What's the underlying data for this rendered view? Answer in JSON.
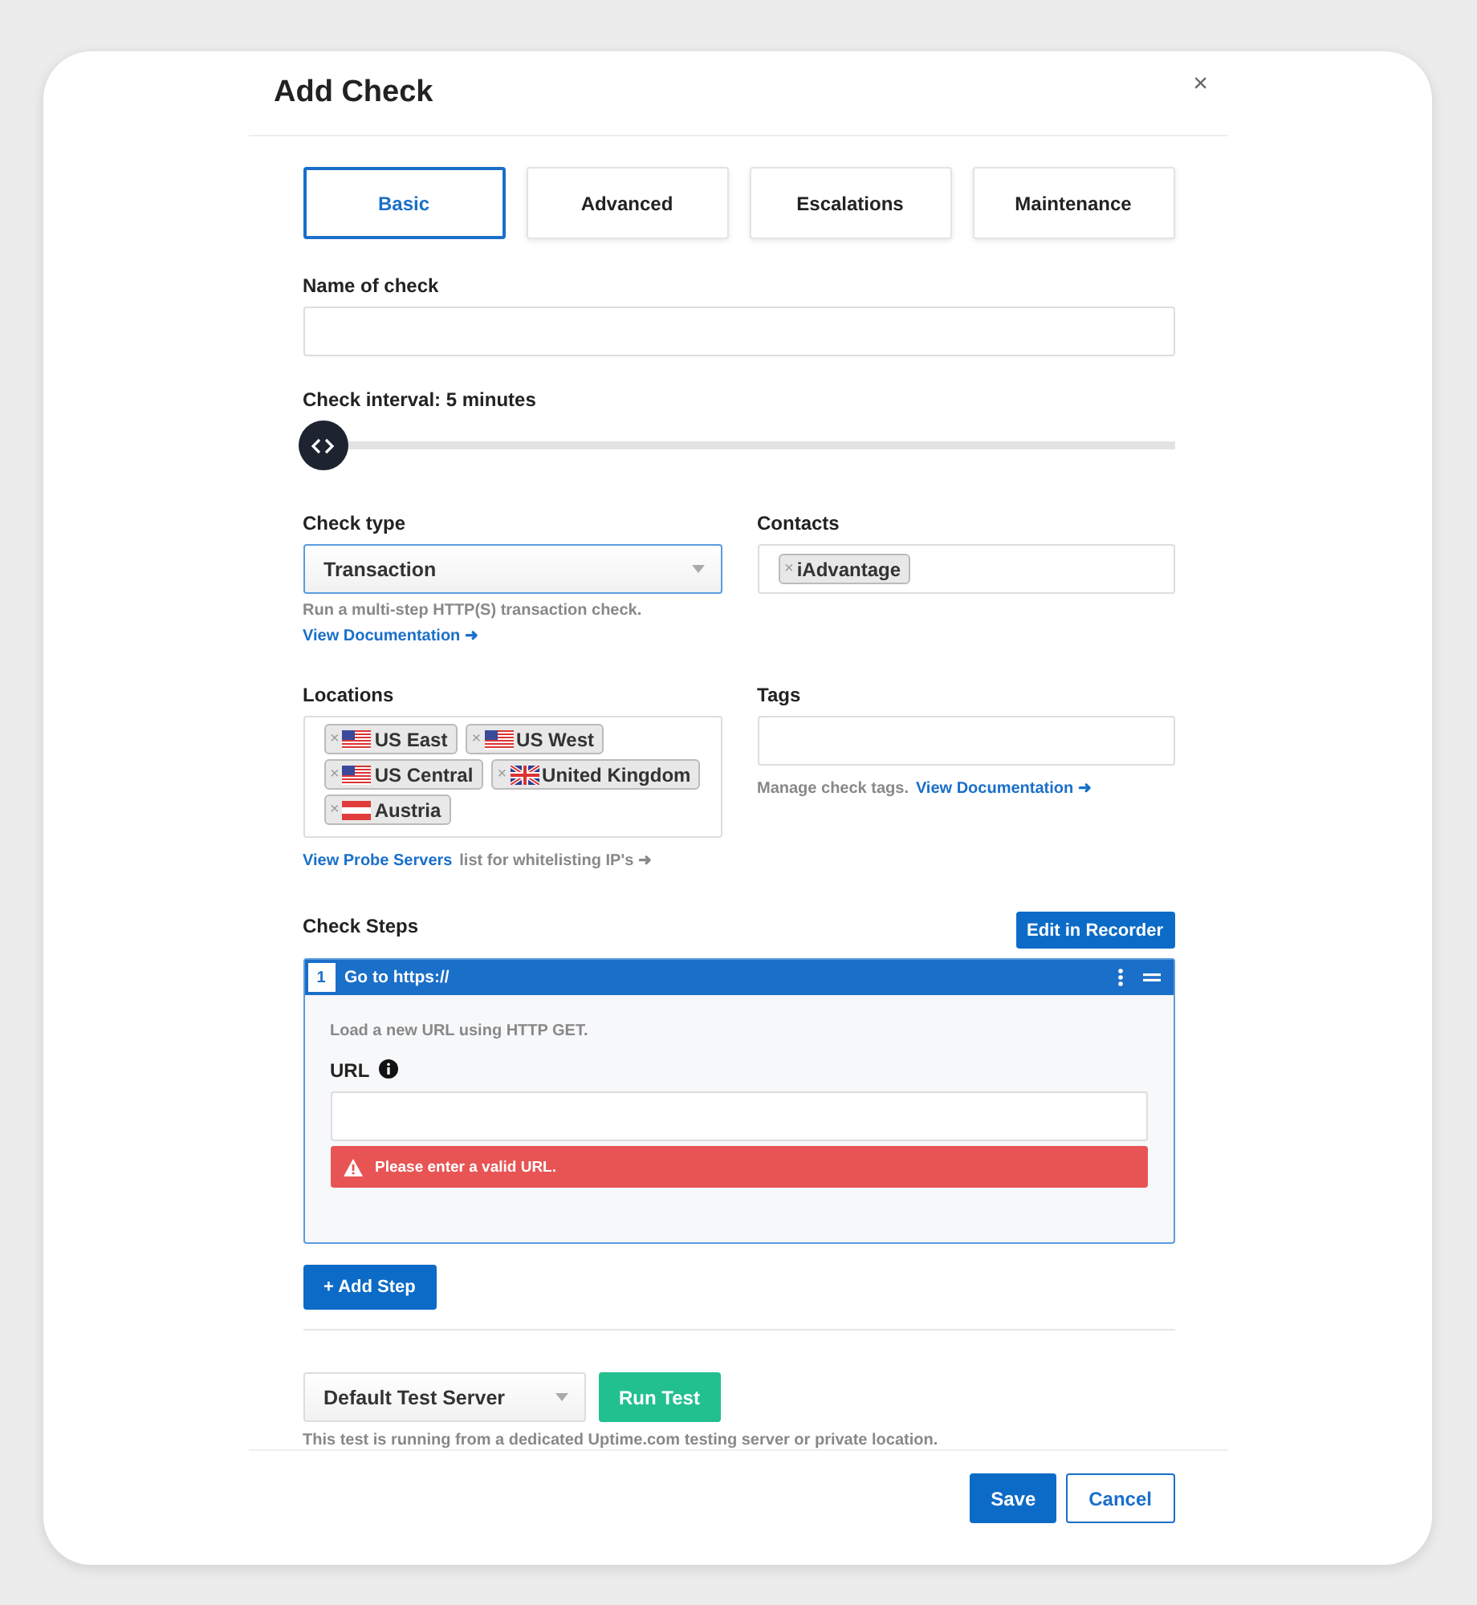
{
  "dialog": {
    "title": "Add Check",
    "close": "×"
  },
  "tabs": [
    {
      "label": "Basic",
      "selected": true
    },
    {
      "label": "Advanced",
      "selected": false
    },
    {
      "label": "Escalations",
      "selected": false
    },
    {
      "label": "Maintenance",
      "selected": false
    }
  ],
  "name_field": {
    "label": "Name of check"
  },
  "interval": {
    "label": "Check interval: 5 minutes",
    "level": 0
  },
  "check_type": {
    "label": "Check type",
    "value": "Transaction",
    "help": "Run a multi-step HTTP(S) transaction check.",
    "link": "View Documentation ➜"
  },
  "contacts": {
    "label": "Contacts",
    "chips": [
      {
        "remove": "×",
        "label": "iAdvantage"
      }
    ]
  },
  "locations": {
    "label": "Locations",
    "chips": [
      {
        "remove": "×",
        "kind": "stars_stripes",
        "label": "US East"
      },
      {
        "remove": "×",
        "kind": "stars_stripes",
        "label": "US West"
      },
      {
        "remove": "×",
        "kind": "stars_stripes",
        "label": "US Central"
      },
      {
        "remove": "×",
        "kind": "union",
        "label": "United Kingdom"
      },
      {
        "remove": "×",
        "kind": "triband",
        "label": "Austria"
      }
    ],
    "link": "View Probe Servers",
    "help": "list for whitelisting IP's ➜"
  },
  "tags": {
    "label": "Tags",
    "help": "Manage check tags.",
    "link": "View Documentation ➜"
  },
  "check_steps": {
    "label": "Check Steps",
    "recorder_button": "Edit in Recorder",
    "steps": [
      {
        "number": "1",
        "title": "Go to https://",
        "description": "Load a new URL using HTTP GET.",
        "field_label": "URL",
        "error": "Please enter a valid URL."
      }
    ],
    "add_button": "+ Add Step"
  },
  "test": {
    "server": "Default Test Server",
    "run_button": "Run Test",
    "help": "This test is running from a dedicated Uptime.com testing server or private location."
  },
  "footer": {
    "save": "Save",
    "cancel": "Cancel"
  }
}
